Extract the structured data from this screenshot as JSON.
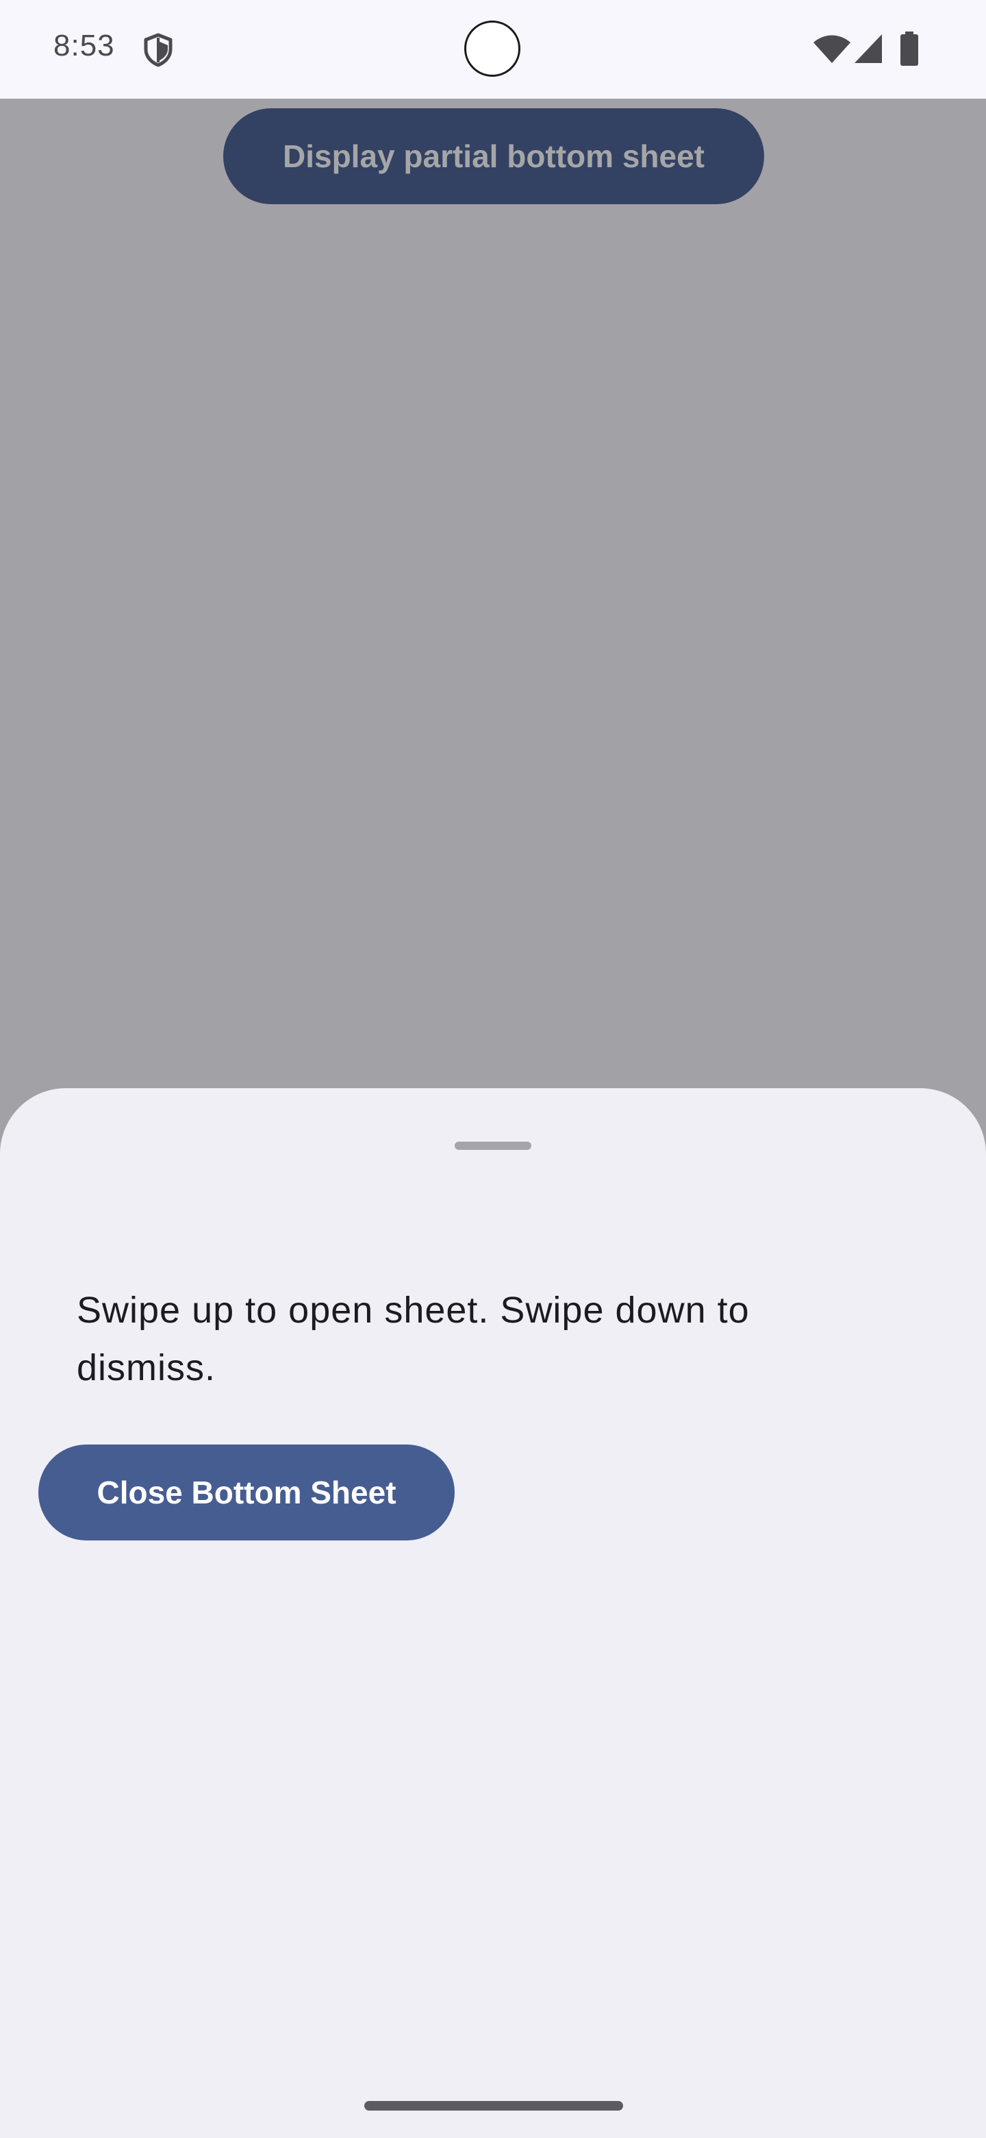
{
  "status_bar": {
    "time": "8:53",
    "icons": [
      "shield-icon",
      "wifi-icon",
      "signal-icon",
      "battery-icon"
    ]
  },
  "main": {
    "display_button_label": "Display partial bottom sheet"
  },
  "bottom_sheet": {
    "message": "Swipe up to open sheet. Swipe down to dismiss.",
    "close_button_label": "Close Bottom Sheet"
  },
  "colors": {
    "primary": "#465d92",
    "sheet_background": "#f0eff6",
    "scrim": "rgba(20,20,24,0.38)"
  }
}
